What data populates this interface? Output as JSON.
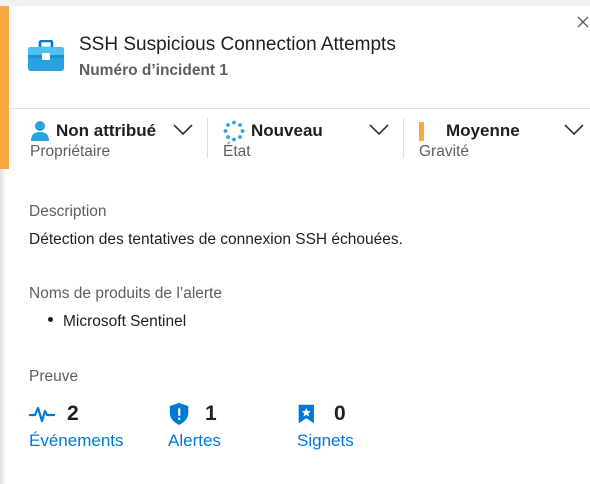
{
  "header": {
    "title": "SSH Suspicious Connection Attempts",
    "subtitle": "Numéro d’incident 1",
    "icon": "briefcase-icon",
    "accent_color": "#f7a844"
  },
  "fields": {
    "owner": {
      "value": "Non attribué",
      "label": "Propriétaire",
      "icon": "person-icon"
    },
    "status": {
      "value": "Nouveau",
      "label": "État",
      "icon": "spinner-icon"
    },
    "severity": {
      "value": "Moyenne",
      "label": "Gravité",
      "icon": "severity-bar-icon",
      "color": "#f7a844"
    }
  },
  "description": {
    "label": "Description",
    "text": "Détection des tentatives de connexion SSH échouées."
  },
  "alert_products": {
    "label": "Noms de produits de l’alerte",
    "items": [
      "Microsoft Sentinel"
    ]
  },
  "evidence": {
    "label": "Preuve",
    "items": [
      {
        "count": "2",
        "label": "Événements",
        "icon": "pulse-icon"
      },
      {
        "count": "1",
        "label": "Alertes",
        "icon": "shield-icon"
      },
      {
        "count": "0",
        "label": "Signets",
        "icon": "bookmark-icon"
      }
    ]
  },
  "colors": {
    "link": "#0078d4",
    "icon_blue": "#0078d4"
  }
}
